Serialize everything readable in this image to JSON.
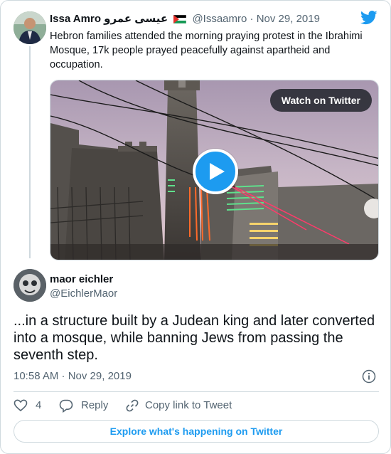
{
  "parent_tweet": {
    "name": "Issa Amro",
    "name_arabic": "عيسى عمرو",
    "handle": "@Issaamro",
    "separator": "·",
    "date": "Nov 29, 2019",
    "text": "Hebron families attended the morning praying protest in the Ibrahimi Mosque, 17k people prayed peacefully against apartheid and occupation.",
    "flag_icon": "palestine-flag-icon",
    "video": {
      "watch_label": "Watch on Twitter",
      "play_icon": "play-icon"
    }
  },
  "main_tweet": {
    "name": "maor eichler",
    "handle": "@EichlerMaor",
    "text": "...in a structure built by a Judean king and later converted into a mosque, while banning Jews from passing the seventh step.",
    "timestamp": "10:58 AM · Nov 29, 2019"
  },
  "actions": {
    "like_count": "4",
    "reply_label": "Reply",
    "copy_label": "Copy link to Tweet"
  },
  "explore_label": "Explore what's happening on Twitter",
  "colors": {
    "accent": "#1d9bf0",
    "text": "#0f1419",
    "muted": "#536471",
    "border": "#cfd9de"
  }
}
